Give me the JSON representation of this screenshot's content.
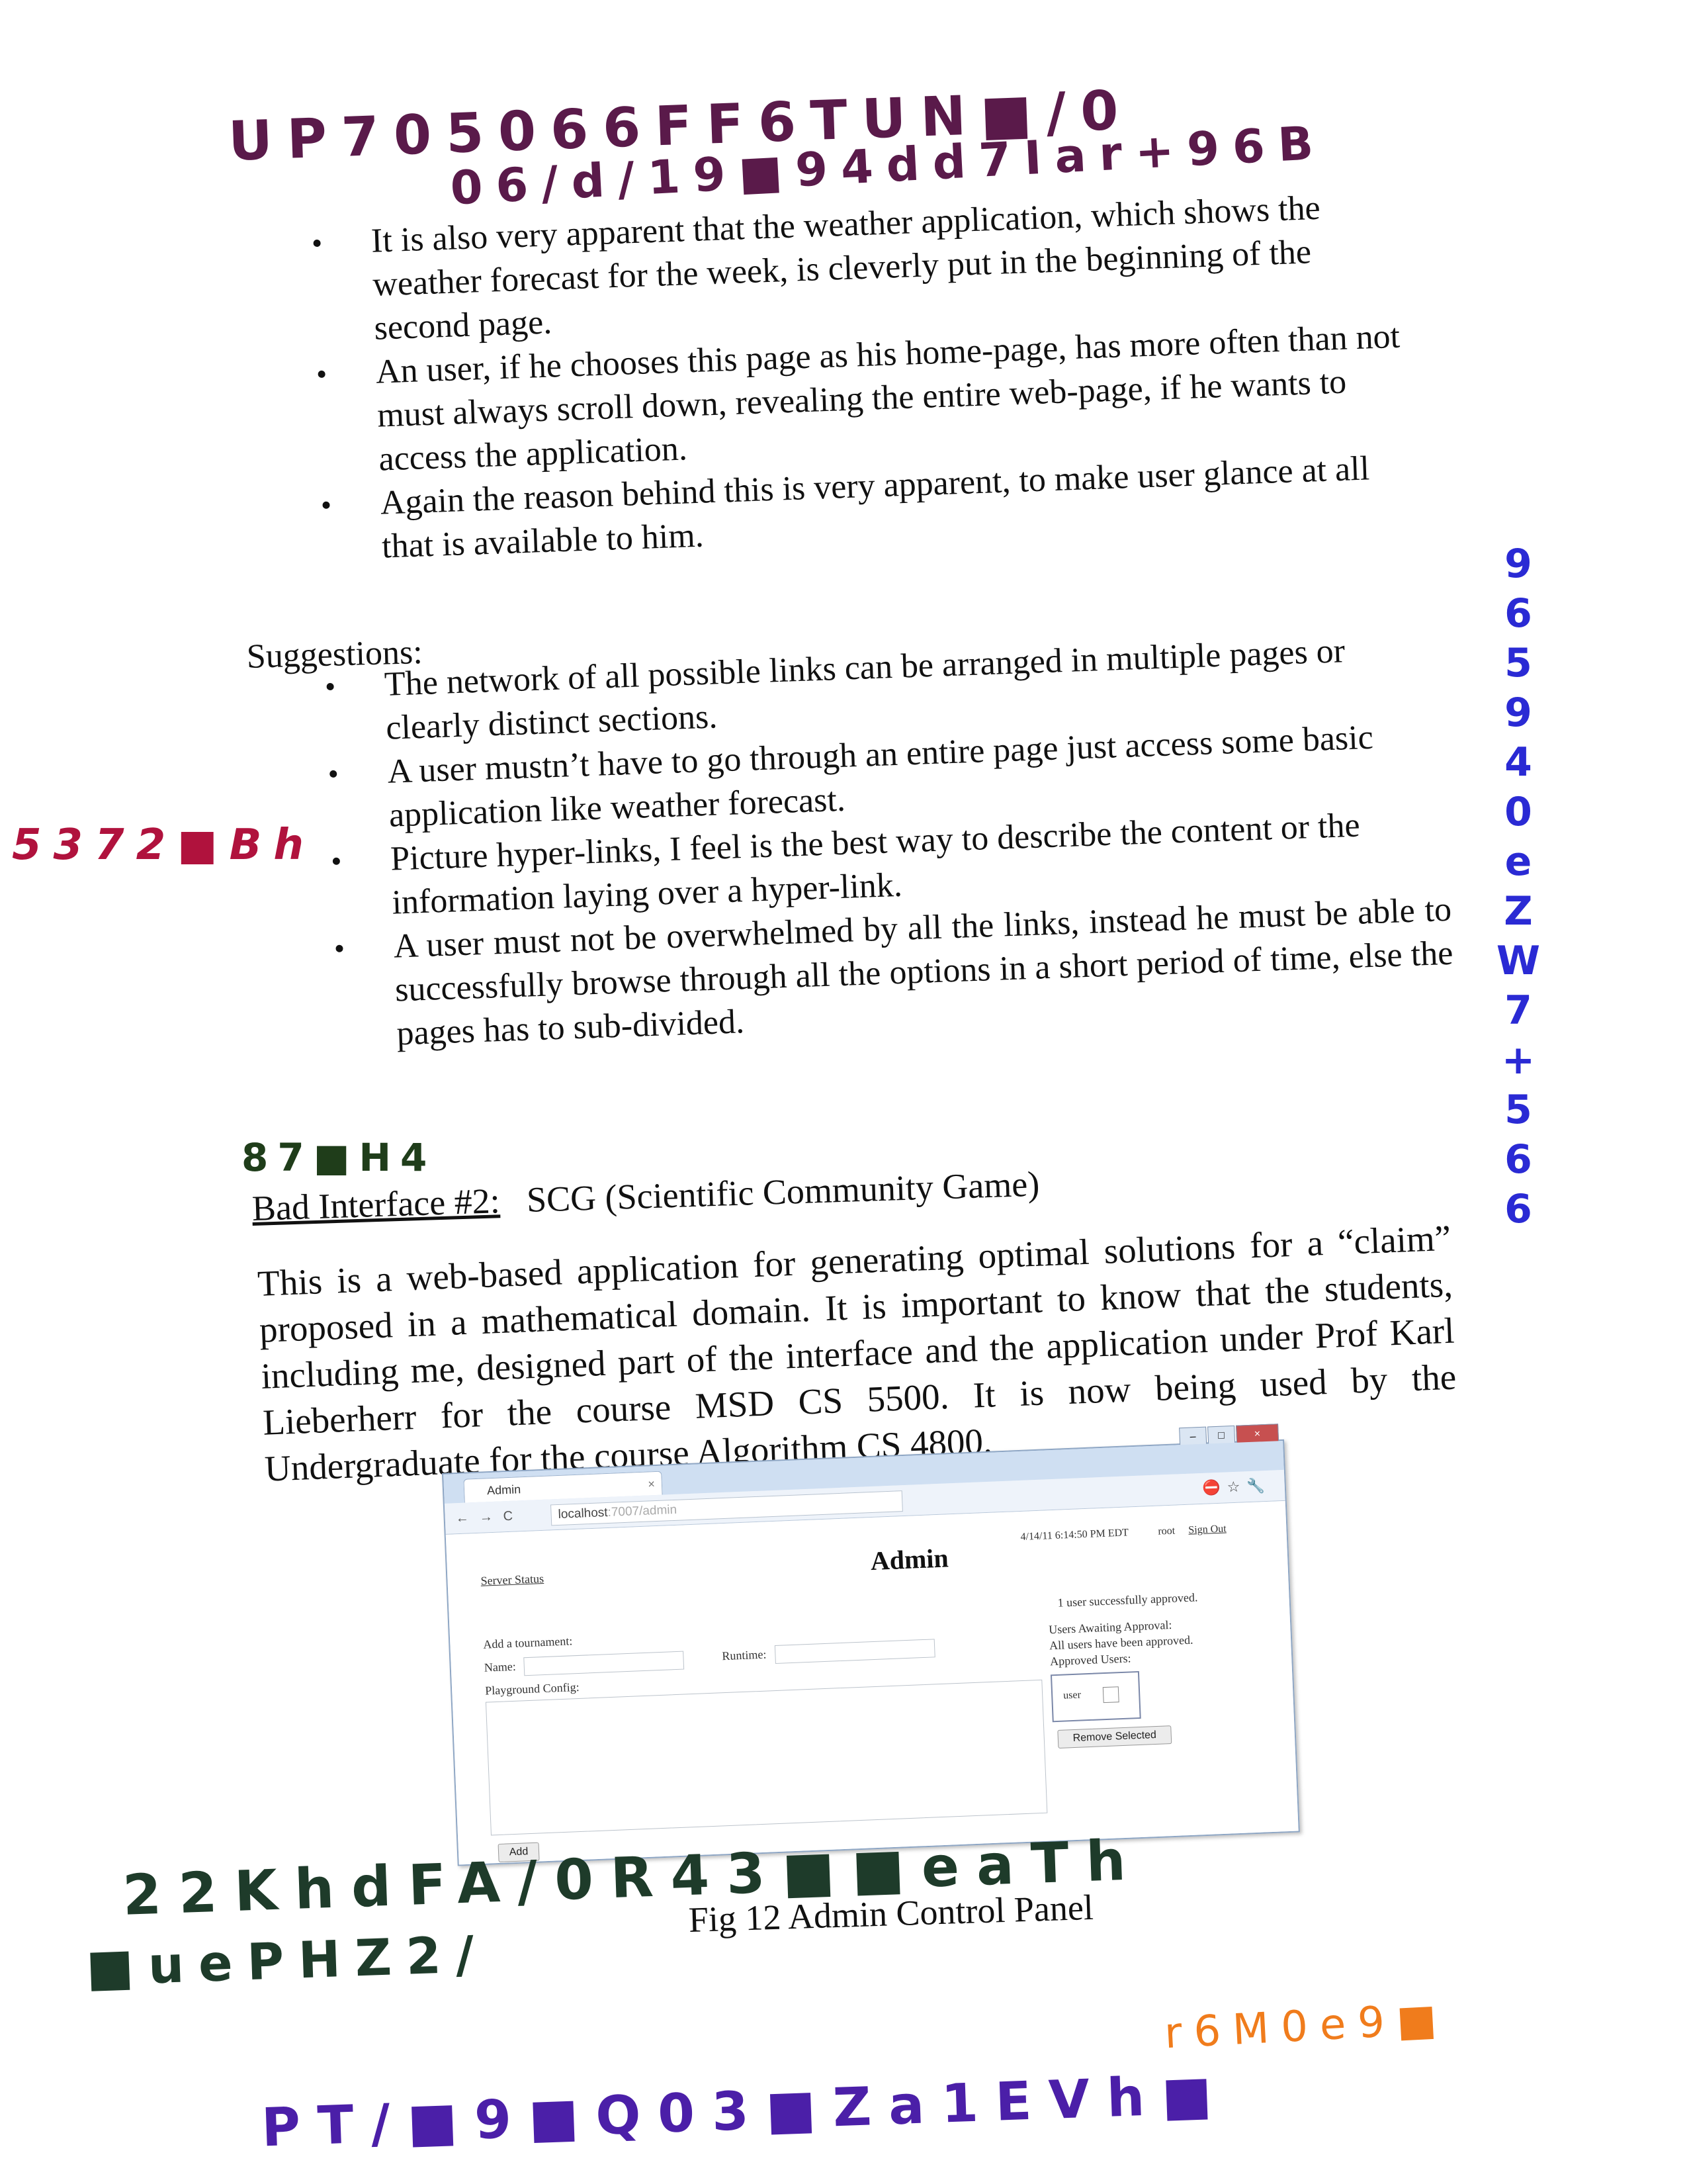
{
  "scrawls": {
    "top_line1": "UP705066FF6TUN■/0",
    "top_line2": "06/d/19■94dd7Iar+96B",
    "left_side": "5372■Bh",
    "right_column": [
      "9",
      "6",
      "5",
      "9",
      "4",
      "0",
      "e",
      "Z",
      "W",
      "7",
      "+",
      "5",
      "6",
      "6"
    ],
    "above_heading": "87■H4",
    "bottom_green_1": "22KhdFA/0R43■■eaTh",
    "bottom_green_2": "■uePHZ2/",
    "bottom_orange": "r6M0e9■",
    "bottom_purple": "PT/■9■Q03■Za1EVh■"
  },
  "scrawl_colors": {
    "top": "#5a1a4a",
    "left_side": "#b0123d",
    "right_column": "#2a2ad4",
    "above_heading": "#1f3d1a",
    "bottom_green": "#1e3b2a",
    "bottom_orange": "#f07c1c",
    "bottom_purple": "#4b1fa8"
  },
  "bullets_top": [
    "It is also very apparent that the weather application, which shows the weather forecast for the week, is cleverly put in the beginning of the second page.",
    "An user, if he chooses this page as his home-page, has more often than not must always scroll down, revealing the entire web-page, if he wants to access the application.",
    "Again the reason behind this is very apparent, to make user glance at all that is available to him."
  ],
  "suggestions_heading": "Suggestions:",
  "suggestions": [
    "The network of all possible links can be arranged in multiple pages or clearly distinct sections.",
    "A user mustn’t have to go through an entire page just access some basic application like weather forecast.",
    "Picture hyper-links, I feel is the best way to describe the content or the information laying over a hyper-link.",
    "A user must not be overwhelmed by all the links, instead he must be able to successfully browse through all the options in a short period of time, else the pages has to sub-divided."
  ],
  "section_heading": {
    "label": "Bad Interface #2:",
    "title": "SCG (Scientific Community Game)"
  },
  "paragraph": "This is a web-based application for generating optimal solutions for a “claim” proposed in a mathematical domain. It is important to know that the students, including me, designed part of the interface and the application under Prof Karl Lieberherr for the course MSD CS 5500. It is now being used by the Undergraduate for the course Algorithm CS 4800.",
  "figure_caption": "Fig 12 Admin Control Panel",
  "screenshot": {
    "tab_title": "Admin",
    "url_host": "localhost",
    "url_path": ":7007/admin",
    "page_title": "Admin",
    "server_status_link": "Server Status",
    "datetime": "4/14/11 6:14:50 PM EDT",
    "user": "root",
    "sign_out": "Sign Out",
    "add_tournament": "Add a tournament:",
    "name_label": "Name:",
    "runtime_label": "Runtime:",
    "playground_config_label": "Playground Config:",
    "add_button": "Add",
    "approved_message": "1 user successfully approved.",
    "awaiting_label": "Users Awaiting Approval:",
    "all_approved": "All users have been approved.",
    "approved_users_label": "Approved Users:",
    "approved_user": "user",
    "remove_button": "Remove Selected"
  }
}
